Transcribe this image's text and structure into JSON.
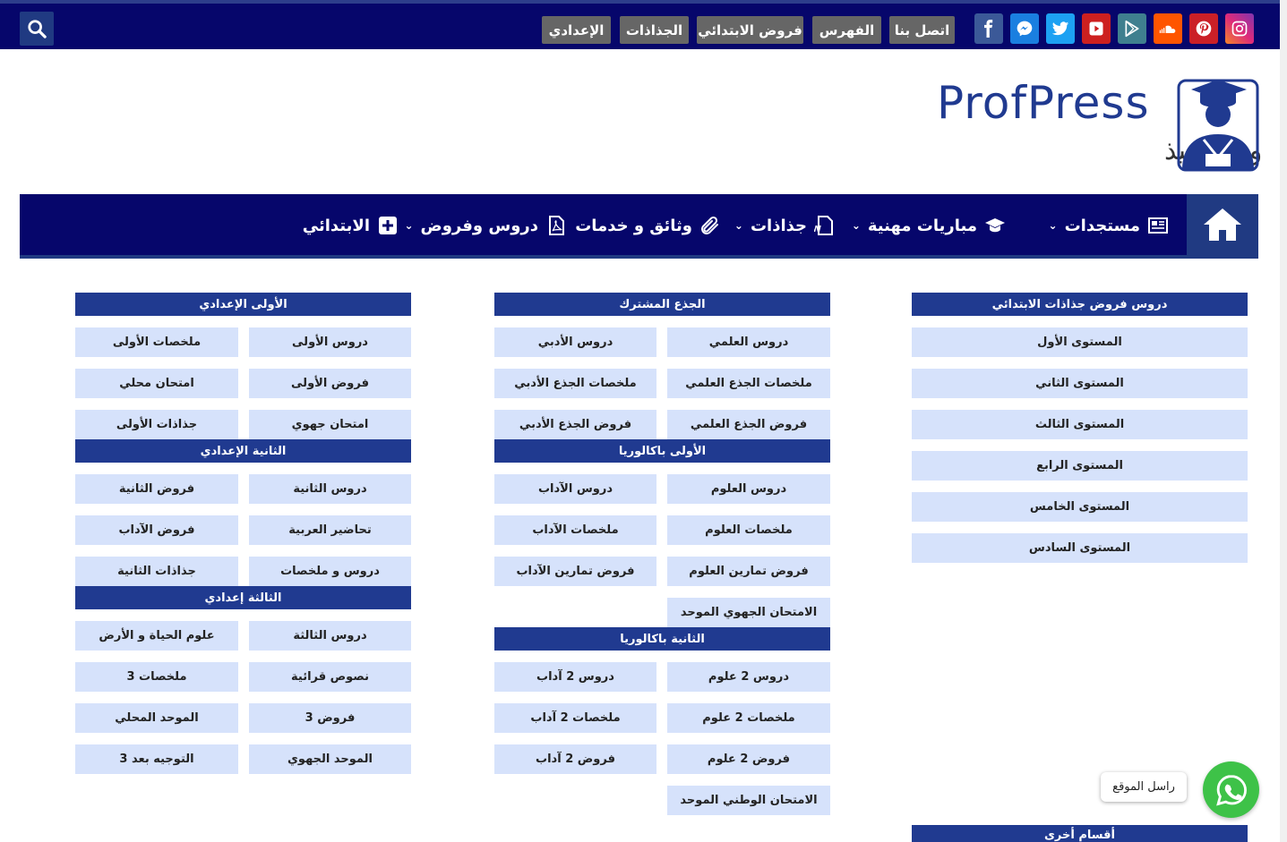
{
  "topbar": {
    "social_icons": [
      {
        "name": "instagram-icon",
        "color": "#bc2a8d"
      },
      {
        "name": "pinterest-icon",
        "color": "#cb2027"
      },
      {
        "name": "soundcloud-icon",
        "color": "#ff5500"
      },
      {
        "name": "google-play-icon",
        "color": "#3f7f8f"
      },
      {
        "name": "youtube-icon",
        "color": "#cd201f"
      },
      {
        "name": "twitter-icon",
        "color": "#1da1f2"
      },
      {
        "name": "messenger-icon",
        "color": "#1a7fe0"
      },
      {
        "name": "facebook-icon",
        "color": "#3b5998"
      }
    ],
    "links": [
      "اتصل بنا",
      "الفهرس",
      "فروض الابتدائي",
      "الجذاذات",
      "الإعدادي"
    ]
  },
  "logo": {
    "brand": "ProfPress",
    "tagline": "للأساتذة و التلاميذ"
  },
  "nav": {
    "items": [
      {
        "label": "مستجدات",
        "icon": "newspaper-icon",
        "dropdown": true
      },
      {
        "label": "مباريات مهنية",
        "icon": "graduation-cap-icon",
        "dropdown": true
      },
      {
        "label": "جذاذات",
        "icon": "word-file-icon",
        "dropdown": true
      },
      {
        "label": "وثائق و خدمات",
        "icon": "paperclip-icon",
        "dropdown": false
      },
      {
        "label": "دروس وفروض",
        "icon": "pdf-file-icon",
        "dropdown": true
      },
      {
        "label": "الابتدائي",
        "icon": "plus-square-icon",
        "dropdown": false
      }
    ]
  },
  "sections": {
    "primary": {
      "title": "دروس فروض جذاذات الابتدائي",
      "items": [
        "المستوى الأول",
        "المستوى الثاني",
        "المستوى الثالث",
        "المستوى الرابع",
        "المستوى الخامس",
        "المستوى السادس"
      ]
    },
    "other": {
      "title": "أقسام أخرى"
    },
    "common_core": {
      "title": "الجذع المشترك",
      "items": [
        "دروس العلمي",
        "دروس الأدبي",
        "ملخصات الجذع العلمي",
        "ملخصات الجذع الأدبي",
        "فروض الجذع العلمي",
        "فروض الجذع الأدبي"
      ]
    },
    "bac1": {
      "title": "الأولى باكالوريا",
      "items": [
        "دروس العلوم",
        "دروس الآداب",
        "ملخصات العلوم",
        "ملخصات الآداب",
        "فروض تمارين العلوم",
        "فروض تمارين الآداب",
        "الامتحان الجهوي الموحد"
      ]
    },
    "bac2": {
      "title": "الثانية باكالوريا",
      "items": [
        "دروس 2 علوم",
        "دروس 2 آداب",
        "ملخصات 2 علوم",
        "ملخصات 2 آداب",
        "فروض 2 علوم",
        "فروض 2 آداب",
        "الامتحان الوطني الموحد"
      ]
    },
    "prep1": {
      "title": "الأولى الإعدادي",
      "items": [
        "دروس الأولى",
        "ملخصات الأولى",
        "فروض الأولى",
        "امتحان محلي",
        "امتحان جهوي",
        "جذاذات الأولى"
      ]
    },
    "prep2": {
      "title": "الثانية الإعدادي",
      "items": [
        "دروس الثانية",
        "فروض الثانية",
        "تحاضير العربية",
        "فروض الآداب",
        "دروس و ملخصات",
        "جذاذات الثانية"
      ]
    },
    "prep3": {
      "title": "الثالثة إعدادي",
      "items": [
        "دروس الثالثة",
        "علوم الحياة و الأرض",
        "نصوص قرائية",
        "ملخصات 3",
        "فروض 3",
        "الموحد المحلي",
        "الموحد الجهوي",
        "التوجيه بعد 3"
      ]
    }
  },
  "whatsapp": {
    "label": "راسل الموقع"
  }
}
